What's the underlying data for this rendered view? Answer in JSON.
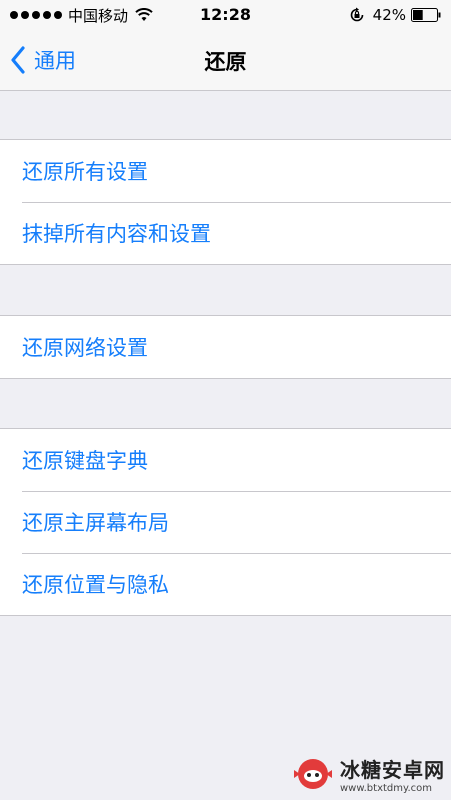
{
  "status_bar": {
    "carrier": "中国移动",
    "time": "12:28",
    "battery_percent": "42%",
    "battery_level": 0.42,
    "signal_bars": 5
  },
  "nav": {
    "back_label": "通用",
    "title": "还原"
  },
  "groups": [
    {
      "items": [
        {
          "label": "还原所有设置"
        },
        {
          "label": "抹掉所有内容和设置"
        }
      ]
    },
    {
      "items": [
        {
          "label": "还原网络设置"
        }
      ]
    },
    {
      "items": [
        {
          "label": "还原键盘字典"
        },
        {
          "label": "还原主屏幕布局"
        },
        {
          "label": "还原位置与隐私"
        }
      ]
    }
  ],
  "watermark": {
    "name": "冰糖安卓网",
    "url": "www.btxtdmy.com"
  },
  "colors": {
    "accent": "#157efb",
    "background": "#efeff4",
    "separator": "#c8c7cc"
  }
}
